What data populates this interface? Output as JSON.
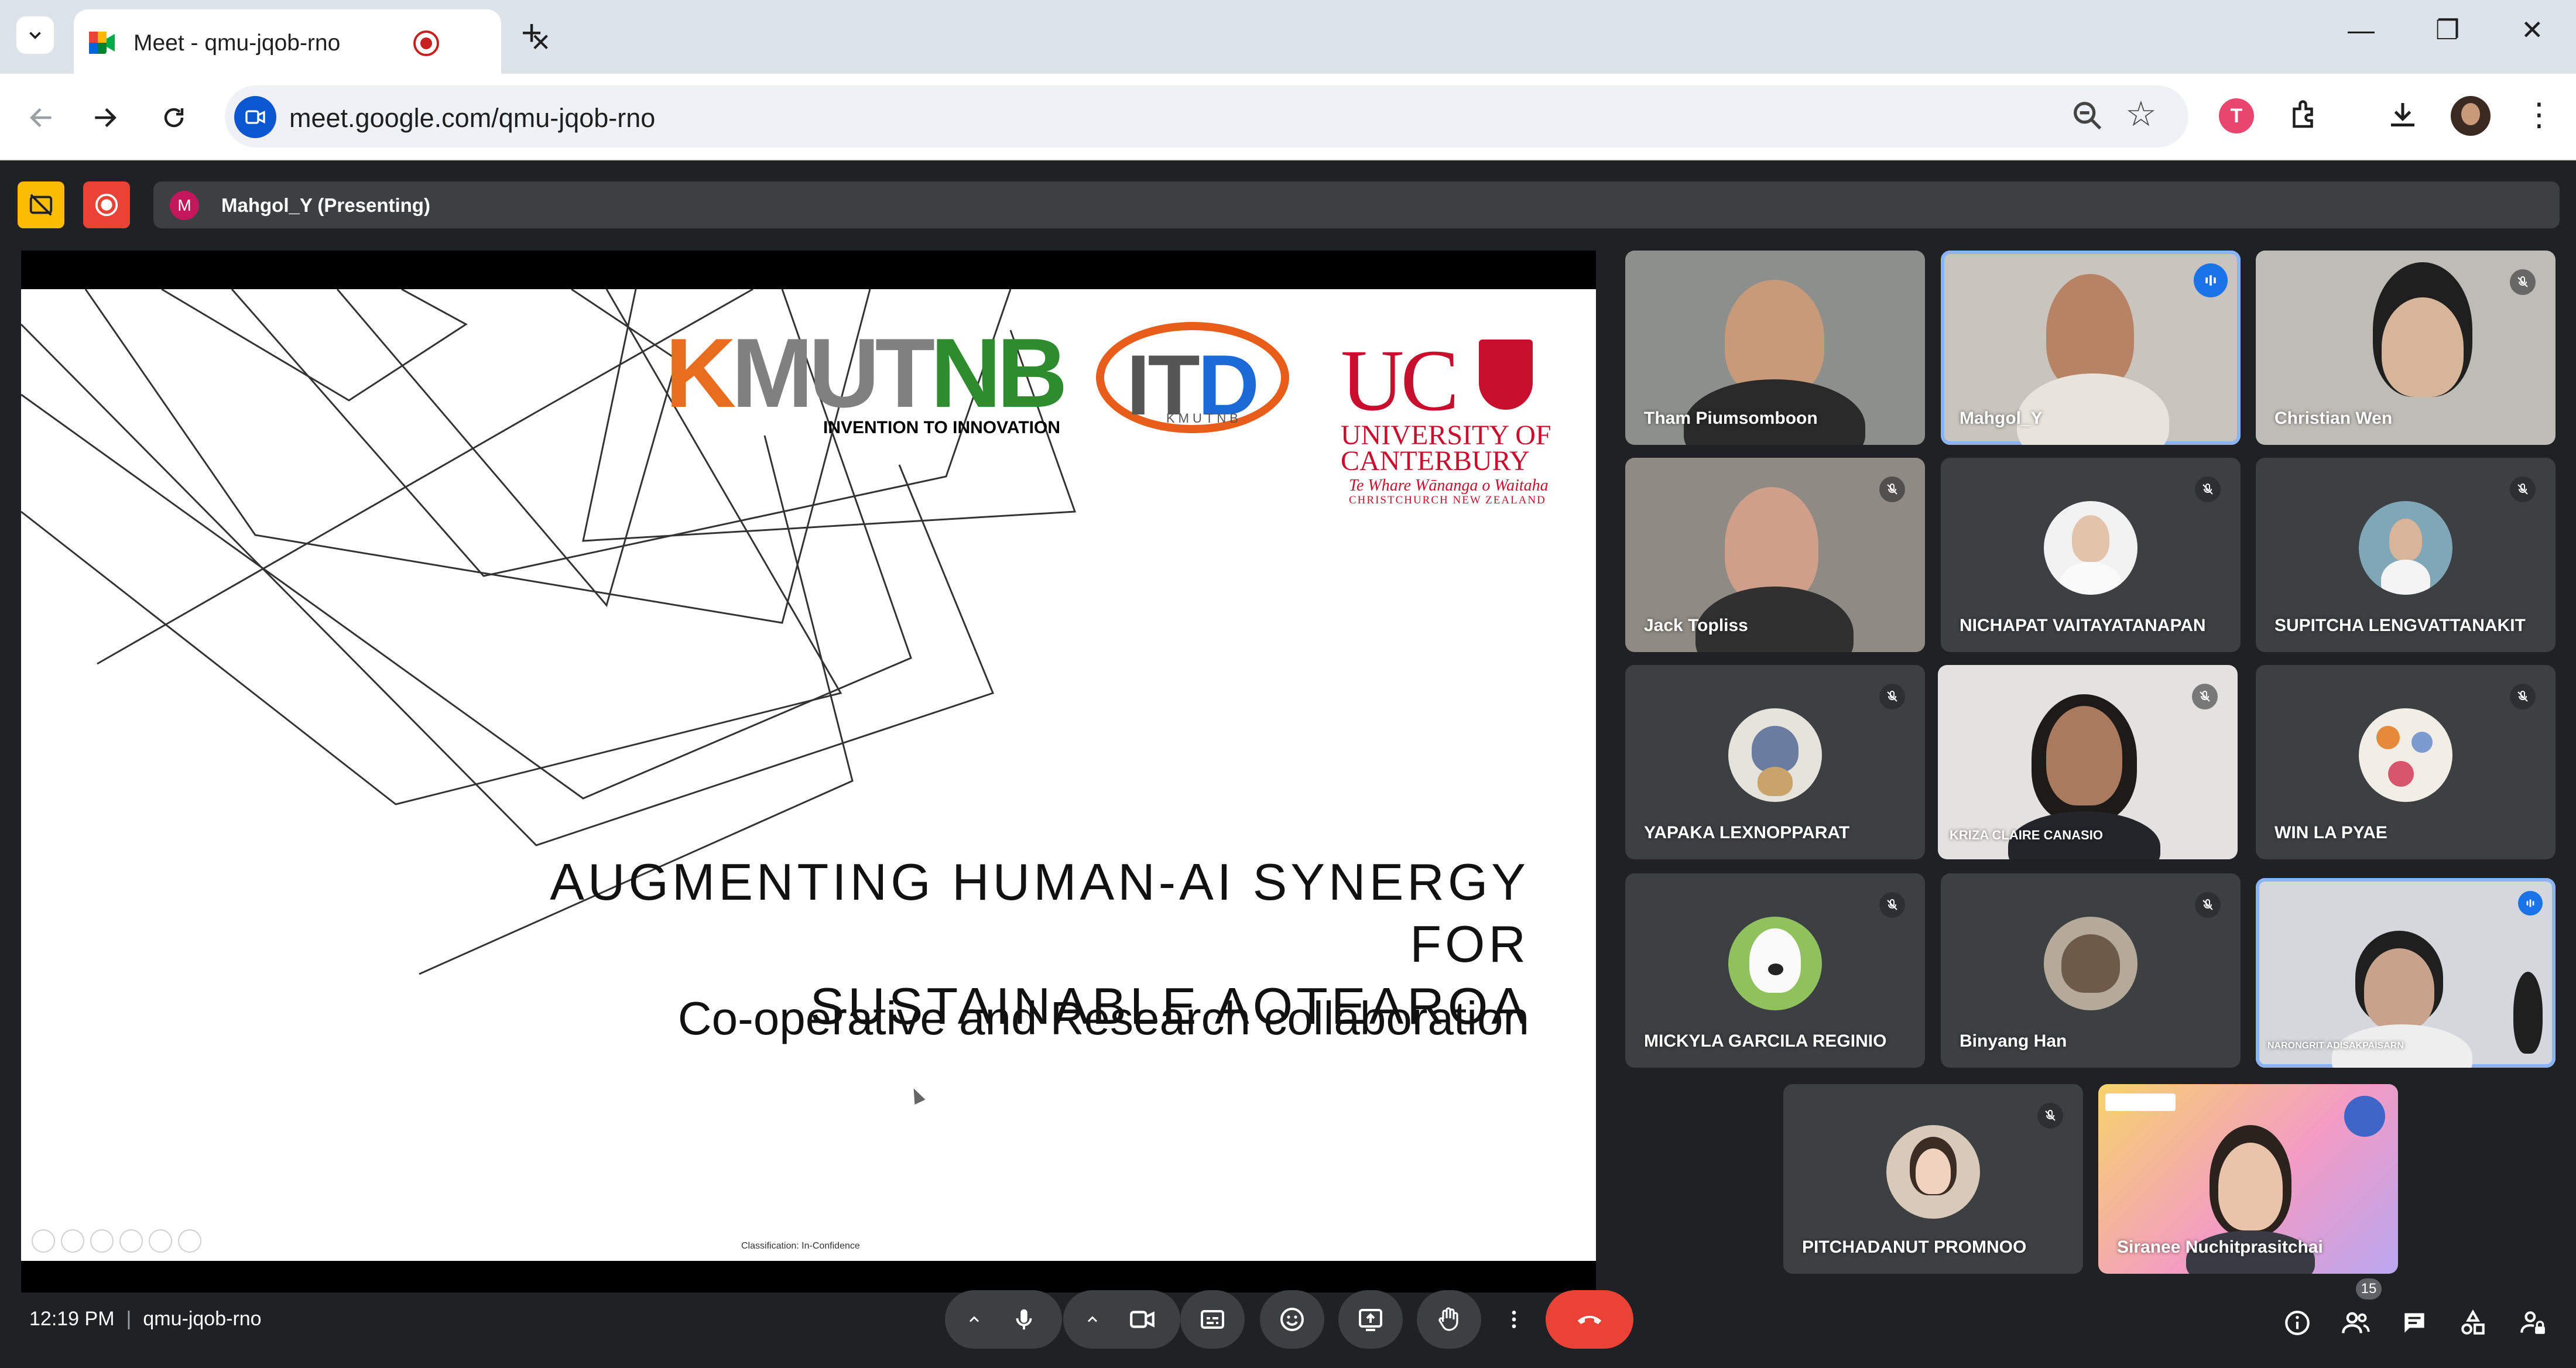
{
  "browser": {
    "tab_title": "Meet - qmu-jqob-rno",
    "url": "meet.google.com/qmu-jqob-rno",
    "profile_initial": "T"
  },
  "presenting_bar": {
    "presenter_initial": "M",
    "presenter_label": "Mahgol_Y (Presenting)"
  },
  "slide": {
    "kmutnb_k": "K",
    "kmutnb_m": "MUT",
    "kmutnb_nb": "NB",
    "kmutnb_tagline": "INVENTION TO INNOVATION",
    "itd_it": "IT",
    "itd_d": "D",
    "itd_sub": "KMUTNB",
    "uc_mark": "UC",
    "uc_line1": "UNIVERSITY OF",
    "uc_line2": "CANTERBURY",
    "uc_maori": "Te Whare Wānanga o Waitaha",
    "uc_city": "CHRISTCHURCH NEW ZEALAND",
    "title": "AUGMENTING HUMAN-AI SYNERGY FOR\nSUSTAINABLE AOTEAROA",
    "subtitle": "Co-operative and Research collaboration",
    "classification": "Classification: In-Confidence"
  },
  "participants": [
    {
      "name": "Tham Piumsomboon",
      "muted": false,
      "video": true
    },
    {
      "name": "Mahgol_Y",
      "muted": false,
      "video": true,
      "speaking": true
    },
    {
      "name": "Christian Wen",
      "muted": true,
      "video": true
    },
    {
      "name": "Jack Topliss",
      "muted": true,
      "video": true
    },
    {
      "name": "NICHAPAT VAITAYATANAPAN",
      "muted": true,
      "video": false
    },
    {
      "name": "SUPITCHA LENGVATTANAKIT",
      "muted": true,
      "video": false
    },
    {
      "name": "YAPAKA LEXNOPPARAT",
      "muted": true,
      "video": false
    },
    {
      "name": "KRIZA CLAIRE CANASIO",
      "muted": true,
      "video": true
    },
    {
      "name": "WIN LA PYAE",
      "muted": true,
      "video": false
    },
    {
      "name": "MICKYLA GARCILA REGINIO",
      "muted": true,
      "video": false
    },
    {
      "name": "Binyang Han",
      "muted": true,
      "video": false
    },
    {
      "name": "NARONGRIT ADISAKPAISARN",
      "muted": false,
      "video": true,
      "speaking": true
    },
    {
      "name": "PITCHADANUT PROMNOO",
      "muted": true,
      "video": false
    },
    {
      "name": "Siranee Nuchitprasitchai",
      "muted": false,
      "video": true
    }
  ],
  "bottom_bar": {
    "time": "12:19 PM",
    "separator": "|",
    "meeting_code": "qmu-jqob-rno",
    "people_count": "15"
  },
  "colors": {
    "meet_bg": "#202124",
    "tile_bg": "#3c4043",
    "end_call": "#ea4335",
    "speaking_blue": "#1a73e8",
    "accent_yellow": "#fbbc04",
    "record_red": "#ea4335"
  }
}
